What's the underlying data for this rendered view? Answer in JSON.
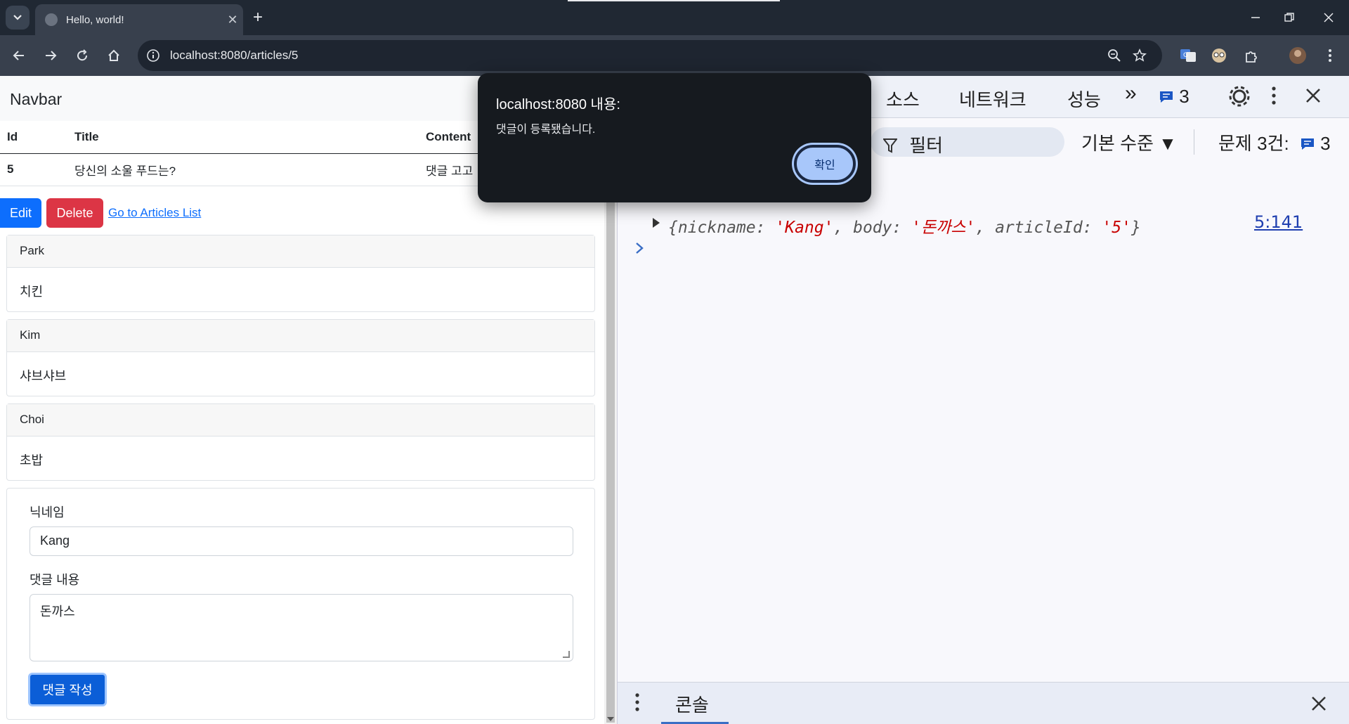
{
  "browser": {
    "tab_title": "Hello, world!",
    "tab_close": "✕",
    "new_tab": "+",
    "url": "localhost:8080/articles/5"
  },
  "page": {
    "navbar_brand": "Navbar",
    "table": {
      "headers": [
        "Id",
        "Title",
        "Content"
      ],
      "row": [
        "5",
        "당신의 소울 푸드는?",
        "댓글 고고"
      ]
    },
    "buttons": {
      "edit": "Edit",
      "delete": "Delete",
      "list_link": "Go to Articles List"
    },
    "comments": [
      {
        "nickname": "Park",
        "body": "치킨"
      },
      {
        "nickname": "Kim",
        "body": "샤브샤브"
      },
      {
        "nickname": "Choi",
        "body": "초밥"
      }
    ],
    "form": {
      "nickname_label": "닉네임",
      "nickname_value": "Kang",
      "body_label": "댓글 내용",
      "body_value": "돈까스",
      "submit": "댓글 작성"
    }
  },
  "devtools": {
    "tabs": [
      "소스",
      "네트워크",
      "성능"
    ],
    "more": "»",
    "issues_badge": "3",
    "filter_placeholder": "필터",
    "level": "기본 수준 ▼",
    "issues_text": "문제 3건:",
    "issues_count": "3",
    "log": {
      "prefix": "{nickname: ",
      "nickname": "'Kang'",
      "body_key": ", body: ",
      "body": "'돈까스'",
      "article_key": ", articleId: ",
      "article": "'5'",
      "suffix": "}",
      "source": "5:141"
    },
    "drawer_tab": "콘솔"
  },
  "dialog": {
    "title": "localhost:8080 내용:",
    "message": "댓글이 등록됐습니다.",
    "ok": "확인"
  },
  "colors": {
    "primary": "#0d6efd",
    "danger": "#dc3545",
    "chrome_dark": "#202833",
    "dialog_bg": "#161a1f"
  }
}
